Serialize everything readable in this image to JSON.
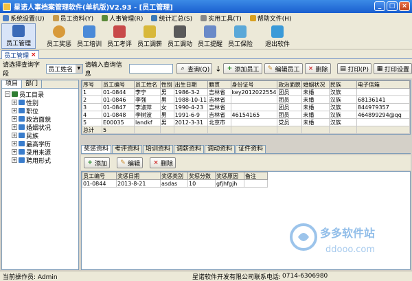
{
  "window": {
    "title": "星诺人事档案管理软件(单机版)V2.93 - [员工管理]",
    "minimize": "_",
    "maximize": "□",
    "close": "×"
  },
  "menu": [
    "系统设置(U)",
    "员工资料(Y)",
    "人事管理(R)",
    "统计汇总(S)",
    "实用工具(T)",
    "帮助文件(H)"
  ],
  "toolbar": [
    "员工管理",
    "员工奖惩",
    "员工培训",
    "员工考评",
    "员工调薪",
    "员工调动",
    "员工提醒",
    "员工保险",
    "退出软件"
  ],
  "doc_tab": {
    "label": "员工管理",
    "close": "×"
  },
  "query": {
    "field_label": "请选择查询字段",
    "field_value": "员工姓名",
    "info_label": "请输入查询信息",
    "info_value": "",
    "query_btn": "查询(Q)",
    "add_btn": "添加员工",
    "edit_btn": "编辑员工",
    "delete_btn": "删除",
    "print_btn": "打印(P)",
    "print_setup_btn": "打印设置"
  },
  "left_tabs": [
    "项目",
    "部门"
  ],
  "tree": {
    "root": "员工目录",
    "items": [
      "性别",
      "职位",
      "政治面貌",
      "婚姻状况",
      "民族",
      "最高学历",
      "录用来源",
      "聘用形式"
    ]
  },
  "employees": {
    "columns": [
      "序号",
      "员工编号",
      "员工姓名",
      "性别",
      "出生日期",
      "籍贯",
      "身份证号",
      "政治面貌",
      "婚姻状况",
      "民族",
      "电子信箱"
    ],
    "rows": [
      [
        "1",
        "01-0844",
        "李宁",
        "男",
        "1986-3-2",
        "吉林省",
        "key2012022554",
        "团员",
        "未婚",
        "汉族",
        ""
      ],
      [
        "2",
        "01-0846",
        "李强",
        "男",
        "1988-10-11",
        "吉林省",
        "",
        "团员",
        "未婚",
        "汉族",
        "68136141"
      ],
      [
        "3",
        "01-0847",
        "李淑萍",
        "女",
        "1990-4-23",
        "吉林省",
        "",
        "团员",
        "未婚",
        "汉族",
        "844979357"
      ],
      [
        "4",
        "01-0848",
        "李树波",
        "男",
        "1991-6-9",
        "吉林省",
        "46154165",
        "团员",
        "未婚",
        "汉族",
        "464899294@qq"
      ],
      [
        "5",
        "E00035",
        "landkf",
        "男",
        "2012-3-31",
        "北京市",
        "",
        "党员",
        "未婚",
        "汉族",
        ""
      ]
    ],
    "total_label": "总计",
    "total_value": "5"
  },
  "sub_tabs": [
    "奖惩资料",
    "考评资料",
    "培训资料",
    "调薪资料",
    "调动资料",
    "证件资料"
  ],
  "sub_toolbar": {
    "add": "添加",
    "edit": "编辑",
    "delete": "删除"
  },
  "rewards": {
    "columns": [
      "员工编号",
      "奖惩日期",
      "奖惩类别",
      "奖惩分数",
      "奖惩原因",
      "备注"
    ],
    "rows": [
      [
        "01-0844",
        "2013-8-21",
        "asdas",
        "10",
        "gfjhfgjh",
        ""
      ]
    ]
  },
  "status": {
    "operator": "当前操作员: Admin",
    "company": "星诺软件开发有限公司联系电话:",
    "phone": "0714-6306980"
  },
  "watermark": {
    "brand": "多多软件站",
    "url": "ddooo.com"
  }
}
